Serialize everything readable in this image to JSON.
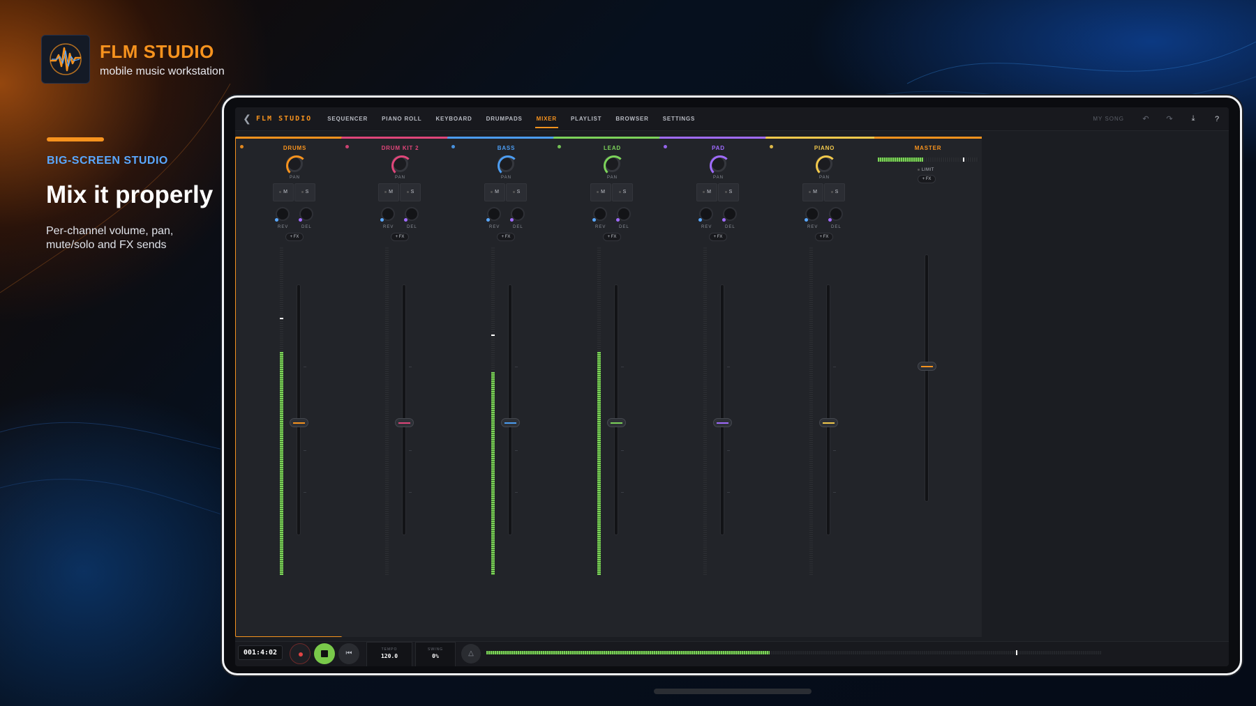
{
  "brand": {
    "name": "FLM STUDIO",
    "subtitle": "mobile music workstation",
    "kicker": "BIG-SCREEN STUDIO",
    "headline": "Mix it properly",
    "description": "Per-channel volume, pan, mute/solo and FX sends",
    "accent_color": "#f7931e"
  },
  "app": {
    "title": "FLM STUDIO",
    "back_icon": "chevron-left-icon",
    "tabs": [
      {
        "label": "SEQUENCER"
      },
      {
        "label": "PIANO ROLL"
      },
      {
        "label": "KEYBOARD"
      },
      {
        "label": "DRUMPADS"
      },
      {
        "label": "MIXER",
        "active": true
      },
      {
        "label": "PLAYLIST"
      },
      {
        "label": "BROWSER"
      },
      {
        "label": "SETTINGS"
      }
    ],
    "song_name": "MY SONG",
    "toolbar_icons": [
      "undo-icon",
      "redo-icon",
      "download-icon",
      "help-icon"
    ]
  },
  "mixer": {
    "labels": {
      "pan": "PAN",
      "mute": "M",
      "solo": "S",
      "reverb": "REV",
      "delay": "DEL",
      "fx": "+ FX"
    },
    "channels": [
      {
        "name": "DRUMS",
        "color": "#f7931e",
        "selected": true,
        "meter_level": 0.68,
        "peak_level": 0.78,
        "fader_level": 0.45,
        "reverb_color": "#5aa8ff",
        "delay_color": "#a06bff"
      },
      {
        "name": "DRUM KIT 2",
        "color": "#e0467a",
        "selected": false,
        "meter_level": 0,
        "peak_level": 0,
        "fader_level": 0.45,
        "reverb_color": "#5aa8ff",
        "delay_color": "#a06bff"
      },
      {
        "name": "BASS",
        "color": "#4c9df2",
        "selected": false,
        "meter_level": 0.62,
        "peak_level": 0.73,
        "fader_level": 0.45,
        "reverb_color": "#5aa8ff",
        "delay_color": "#a06bff"
      },
      {
        "name": "LEAD",
        "color": "#7cd35a",
        "selected": false,
        "meter_level": 0.68,
        "peak_level": 0,
        "fader_level": 0.45,
        "reverb_color": "#5aa8ff",
        "delay_color": "#a06bff"
      },
      {
        "name": "PAD",
        "color": "#a06bff",
        "selected": false,
        "meter_level": 0,
        "peak_level": 0,
        "fader_level": 0.45,
        "reverb_color": "#5aa8ff",
        "delay_color": "#a06bff"
      },
      {
        "name": "PIANO",
        "color": "#f2c94c",
        "selected": false,
        "meter_level": 0,
        "peak_level": 0,
        "fader_level": 0.45,
        "reverb_color": "#5aa8ff",
        "delay_color": "#a06bff"
      }
    ],
    "master": {
      "name": "MASTER",
      "limit_label": "LIMIT",
      "fx_label": "+ FX",
      "meter_level": 0.45,
      "peak_level": 0.85,
      "fader_level": 0.55
    }
  },
  "transport": {
    "time": "001:4:02",
    "tempo_label": "TEMPO",
    "tempo": "120.0",
    "swing_label": "SWING",
    "swing": "0%",
    "meter_level": 0.46,
    "peak_level": 0.86
  }
}
